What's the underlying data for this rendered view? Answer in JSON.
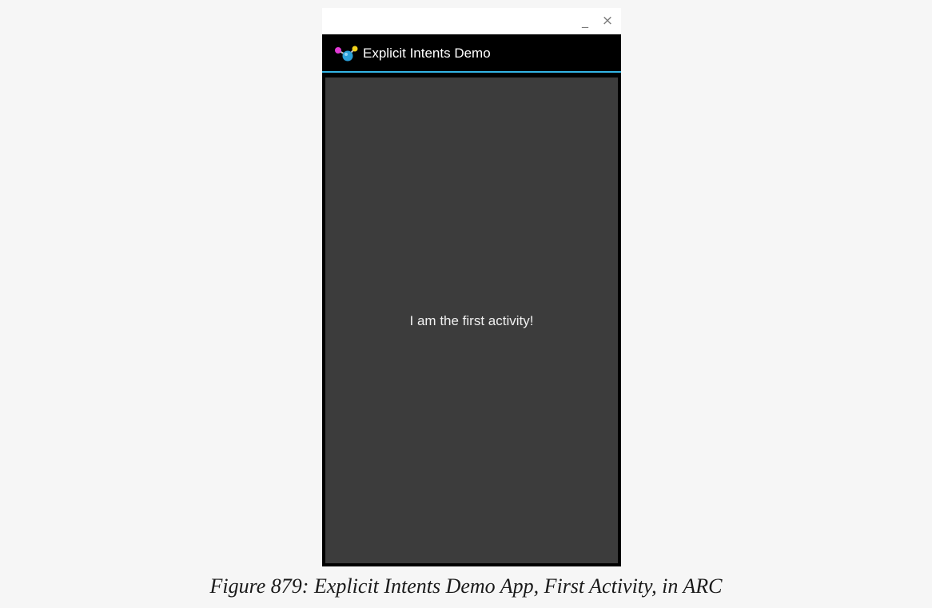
{
  "window": {
    "minimize_glyph": "_",
    "close_glyph": "×"
  },
  "actionbar": {
    "icon": "app-molecule-icon",
    "title": "Explicit Intents Demo",
    "accent_color": "#33b5e5"
  },
  "content": {
    "message": "I am the first activity!"
  },
  "caption": "Figure 879: Explicit Intents Demo App, First Activity, in ARC"
}
